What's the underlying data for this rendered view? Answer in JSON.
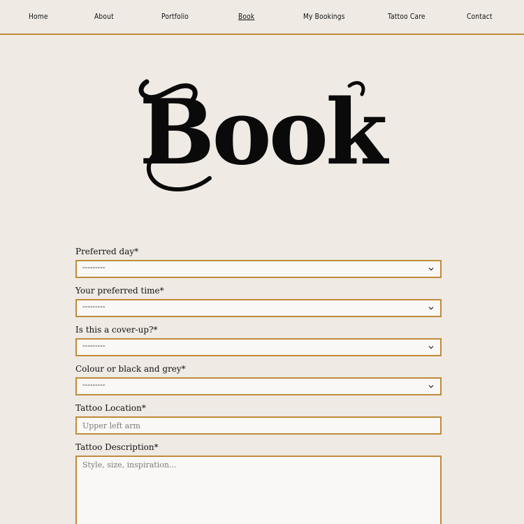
{
  "nav": {
    "items": [
      {
        "label": "Home",
        "active": false
      },
      {
        "label": "About",
        "active": false
      },
      {
        "label": "Portfolio",
        "active": false
      },
      {
        "label": "Book",
        "active": true
      },
      {
        "label": "My Bookings",
        "active": false
      },
      {
        "label": "Tattoo Care",
        "active": false
      },
      {
        "label": "Contact",
        "active": false
      }
    ]
  },
  "hero": {
    "title": "Book"
  },
  "form": {
    "preferred_day": {
      "label": "Preferred day*",
      "value": "---------"
    },
    "preferred_time": {
      "label": "Your preferred time*",
      "value": "---------"
    },
    "cover_up": {
      "label": "Is this a cover-up?*",
      "value": "---------"
    },
    "colour": {
      "label": "Colour or black and grey*",
      "value": "---------"
    },
    "location": {
      "label": "Tattoo Location*",
      "placeholder": "Upper left arm",
      "value": ""
    },
    "description": {
      "label": "Tattoo Description*",
      "placeholder": "Style, size, inspiration...",
      "value": ""
    }
  },
  "colors": {
    "background": "#efeae4",
    "accent": "#c08b3a",
    "field_background": "#f9f8f6",
    "text": "#111111"
  },
  "icons": {
    "select_chevron": "chevron-down-icon"
  }
}
